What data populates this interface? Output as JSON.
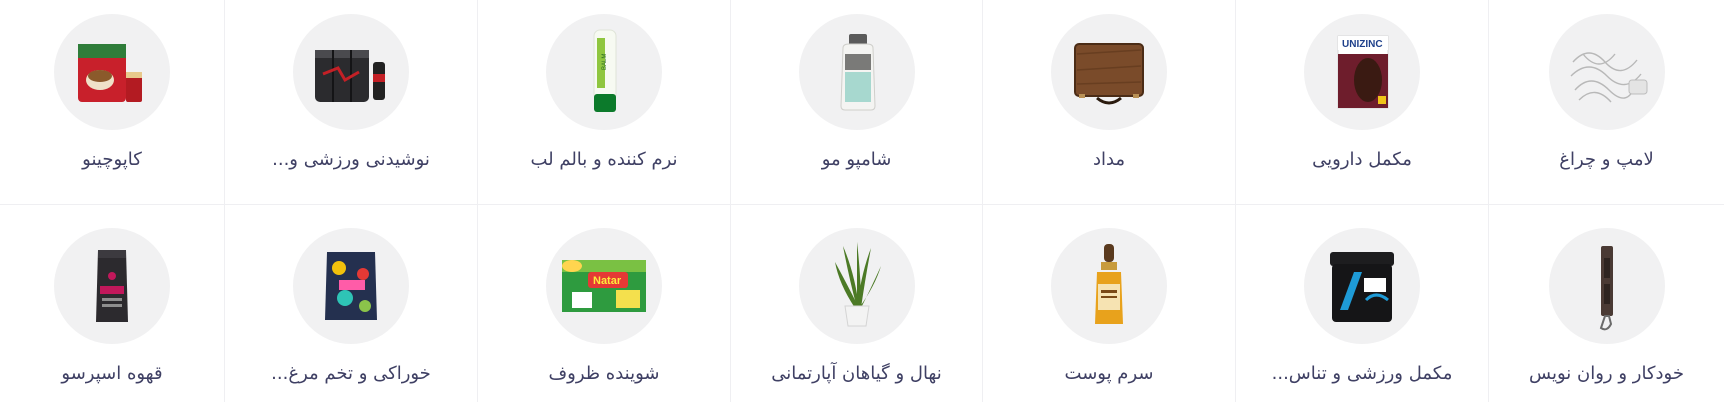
{
  "categories": [
    {
      "label": "کاپوچینو",
      "icon": "cappuccino-pack-icon"
    },
    {
      "label": "نوشیدنی ورزشی و...",
      "icon": "sports-drink-cans-icon"
    },
    {
      "label": "نرم کننده و بالم لب",
      "icon": "lip-balm-icon"
    },
    {
      "label": "شامپو مو",
      "icon": "shampoo-bottle-icon"
    },
    {
      "label": "مداد",
      "icon": "pencil-case-icon"
    },
    {
      "label": "مکمل دارویی",
      "icon": "supplement-box-icon"
    },
    {
      "label": "لامپ و چراغ",
      "icon": "string-lights-icon"
    },
    {
      "label": "قهوه اسپرسو",
      "icon": "espresso-coffee-bag-icon"
    },
    {
      "label": "خوراکی و تخم مرغ...",
      "icon": "snack-pack-icon"
    },
    {
      "label": "شوینده ظروف",
      "icon": "dish-detergent-box-icon"
    },
    {
      "label": "نهال و گیاهان آپارتمانی",
      "icon": "potted-plant-icon"
    },
    {
      "label": "سرم پوست",
      "icon": "serum-dropper-bottle-icon"
    },
    {
      "label": "مکمل ورزشی و تناس...",
      "icon": "protein-tub-icon"
    },
    {
      "label": "خودکار و روان نویس",
      "icon": "pen-case-icon"
    }
  ]
}
